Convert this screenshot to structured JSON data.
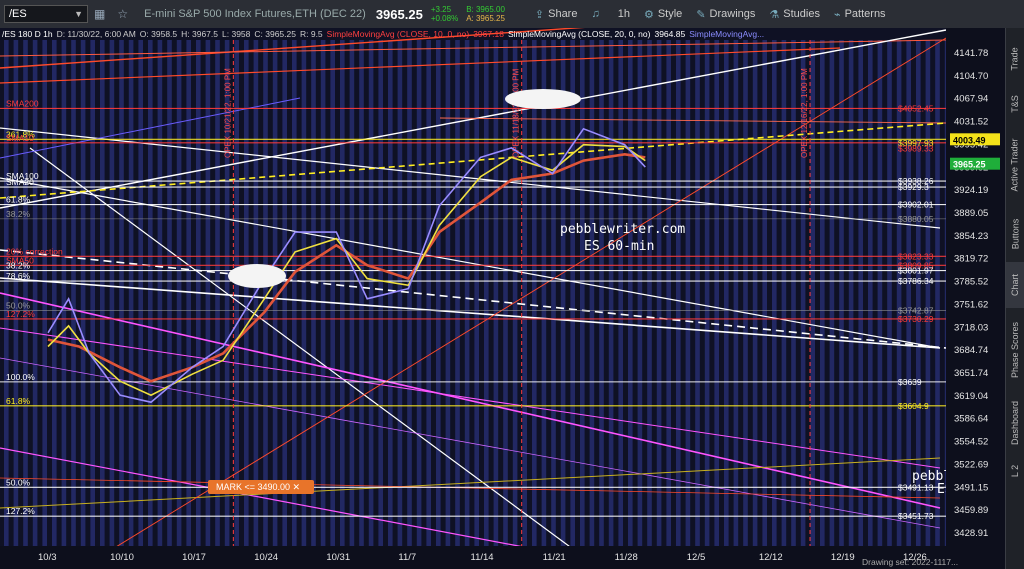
{
  "toolbar": {
    "symbol": "/ES",
    "description": "E-mini S&P 500 Index Futures,ETH (DEC 22)",
    "last": "3965.25",
    "change": "+3.25",
    "change_pct": "+0.08%",
    "bid": "B: 3965.00",
    "ask": "A: 3965.25",
    "share": "Share",
    "interval": "1h",
    "style": "Style",
    "drawings": "Drawings",
    "studies": "Studies",
    "patterns": "Patterns"
  },
  "study_header": {
    "symbol_info": "/ES 180 D 1h",
    "date": "D: 11/30/22, 6:00 AM",
    "open": "O: 3958.5",
    "high": "H: 3967.5",
    "low": "L: 3958",
    "close": "C: 3965.25",
    "range": "R: 9.5",
    "sma10_label": "SimpleMovingAvg (CLOSE, 10, 0, no)",
    "sma10_value": "3967.18",
    "sma20_label": "SimpleMovingAvg (CLOSE, 20, 0, no)",
    "sma20_value": "3964.85",
    "sma3_label": "SimpleMovingAvg..."
  },
  "sidebar": [
    "Trade",
    "T&S",
    "Active Trader",
    "Buttons",
    "Chart",
    "Phase Scores",
    "Dashboard",
    "L 2"
  ],
  "watermark": [
    "pebblewriter.com",
    "ES 60-min"
  ],
  "watermark_tail": [
    "pebbl",
    "ES"
  ],
  "mark": "MARK <= 3490.00 ✕",
  "footer": "Drawing set: 2022-1117...",
  "level_labels_left": [
    {
      "text": "SMA200",
      "price": 4052.45,
      "color": "#ff3b3b"
    },
    {
      "text": "361.8%",
      "price": 4003.49,
      "color": "#ffee22"
    },
    {
      "text": "SMA10",
      "price": 3997.93,
      "color": "#ff3b3b"
    },
    {
      "text": "SMA100",
      "price": 3938.26,
      "color": "#ffffff"
    },
    {
      "text": "SMA20",
      "price": 3929.0,
      "color": "#ffffff"
    },
    {
      "text": "61.8%",
      "price": 3902.01,
      "color": "#ffffff"
    },
    {
      "text": "38.2%",
      "price": 3880.05,
      "color": "#999999"
    },
    {
      "text": "20% correction",
      "price": 3823.33,
      "color": "#ff3b3b"
    },
    {
      "text": "SMA50",
      "price": 3809.85,
      "color": "#ff3b3b"
    },
    {
      "text": "38.2%",
      "price": 3801.97,
      "color": "#ffffff"
    },
    {
      "text": "78.6%",
      "price": 3786.34,
      "color": "#ffffff"
    },
    {
      "text": "50.0%",
      "price": 3742.87,
      "color": "#999999"
    },
    {
      "text": "127.2%",
      "price": 3730.29,
      "color": "#ff3b3b"
    },
    {
      "text": "100.0%",
      "price": 3639,
      "color": "#ffffff"
    },
    {
      "text": "61.8%",
      "price": 3604.9,
      "color": "#ffee22"
    },
    {
      "text": "50.0%",
      "price": 3491.13,
      "color": "#ffffff"
    },
    {
      "text": "127.2%",
      "price": 3451.73,
      "color": "#ffffff"
    }
  ],
  "price_labels_right": [
    {
      "text": "$4052.45",
      "price": 4052.45,
      "color": "#ff3b3b"
    },
    {
      "text": "$3997.93",
      "price": 3997.93,
      "color": "#ffee22"
    },
    {
      "text": "$3989.33",
      "price": 3989.33,
      "color": "#ff3b3b"
    },
    {
      "text": "$3938.26",
      "price": 3938.26,
      "color": "#ffffff"
    },
    {
      "text": "$3929.3",
      "price": 3929.3,
      "color": "#ffffff"
    },
    {
      "text": "$3902.01",
      "price": 3902.01,
      "color": "#ffffff"
    },
    {
      "text": "$3880.05",
      "price": 3880.05,
      "color": "#999999"
    },
    {
      "text": "$3823.33",
      "price": 3823.33,
      "color": "#ff3b3b"
    },
    {
      "text": "$3809.85",
      "price": 3809.85,
      "color": "#ff3b3b"
    },
    {
      "text": "$3801.97",
      "price": 3801.97,
      "color": "#ffffff"
    },
    {
      "text": "$3786.34",
      "price": 3786.34,
      "color": "#ffffff"
    },
    {
      "text": "$3742.87",
      "price": 3742.87,
      "color": "#999999"
    },
    {
      "text": "$3730.29",
      "price": 3730.29,
      "color": "#ff3b3b"
    },
    {
      "text": "$3639",
      "price": 3639,
      "color": "#ffffff"
    },
    {
      "text": "$3604.9",
      "price": 3604.9,
      "color": "#ffee22"
    },
    {
      "text": "$3491.13",
      "price": 3491.13,
      "color": "#ffffff"
    },
    {
      "text": "$3451.73",
      "price": 3451.73,
      "color": "#ffffff"
    }
  ],
  "opex_labels": [
    {
      "text": "OPEX 10/21/22, 1:00 PM",
      "date": "10/21"
    },
    {
      "text": "OPEX 11/18/22, 1:00 PM",
      "date": "11/18"
    },
    {
      "text": "OPEX 12/16/22, 1:00 PM",
      "date": "12/16"
    }
  ],
  "chart_data": {
    "type": "line",
    "title": "",
    "xlabel": "",
    "ylabel": "",
    "x_ticks": [
      "10/3",
      "10/10",
      "10/17",
      "10/24",
      "10/31",
      "11/7",
      "11/14",
      "11/21",
      "11/28",
      "12/5",
      "12/12",
      "12/19",
      "12/26"
    ],
    "y_ticks": [
      4141.78,
      4104.7,
      4067.94,
      4031.52,
      3995.42,
      3959.62,
      3924.19,
      3889.05,
      3854.23,
      3819.72,
      3785.52,
      3751.62,
      3718.03,
      3684.74,
      3651.74,
      3619.04,
      3586.64,
      3554.52,
      3522.69,
      3491.15,
      3459.89,
      3428.91
    ],
    "ylim": [
      3415,
      4175
    ],
    "y_scale": "log",
    "grid": false,
    "current_price": 3965.25,
    "current_price_tag": 4003.49,
    "series": [
      {
        "color": "#e0553a",
        "x": [
          "10/3",
          "10/6",
          "10/10",
          "10/13",
          "10/17",
          "10/20",
          "10/24",
          "10/27",
          "10/31",
          "11/3",
          "11/7",
          "11/10",
          "11/14",
          "11/17",
          "11/21",
          "11/24",
          "11/28",
          "11/30"
        ],
        "values": [
          3700,
          3690,
          3660,
          3640,
          3660,
          3680,
          3740,
          3800,
          3840,
          3810,
          3790,
          3860,
          3905,
          3940,
          3950,
          3970,
          3980,
          3975
        ]
      },
      {
        "color": "#f0e040",
        "x": [
          "10/3",
          "10/5",
          "10/7",
          "10/10",
          "10/13",
          "10/17",
          "10/20",
          "10/24",
          "10/27",
          "10/31",
          "11/3",
          "11/7",
          "11/10",
          "11/14",
          "11/17",
          "11/21",
          "11/24",
          "11/28",
          "11/30"
        ],
        "values": [
          3690,
          3720,
          3680,
          3640,
          3620,
          3650,
          3670,
          3760,
          3830,
          3850,
          3790,
          3780,
          3870,
          3945,
          3975,
          3955,
          3995,
          3992,
          3970
        ]
      },
      {
        "color": "#9a8cff",
        "x": [
          "10/3",
          "10/5",
          "10/7",
          "10/10",
          "10/13",
          "10/17",
          "10/20",
          "10/24",
          "10/27",
          "10/31",
          "11/3",
          "11/7",
          "11/10",
          "11/14",
          "11/17",
          "11/21",
          "11/24",
          "11/28",
          "11/30"
        ],
        "values": [
          3710,
          3760,
          3680,
          3620,
          3610,
          3660,
          3690,
          3790,
          3860,
          3860,
          3760,
          3775,
          3900,
          3975,
          3990,
          3950,
          4020,
          3995,
          3960
        ]
      }
    ],
    "annotation": "pebblewriter.com ES 60-min"
  }
}
